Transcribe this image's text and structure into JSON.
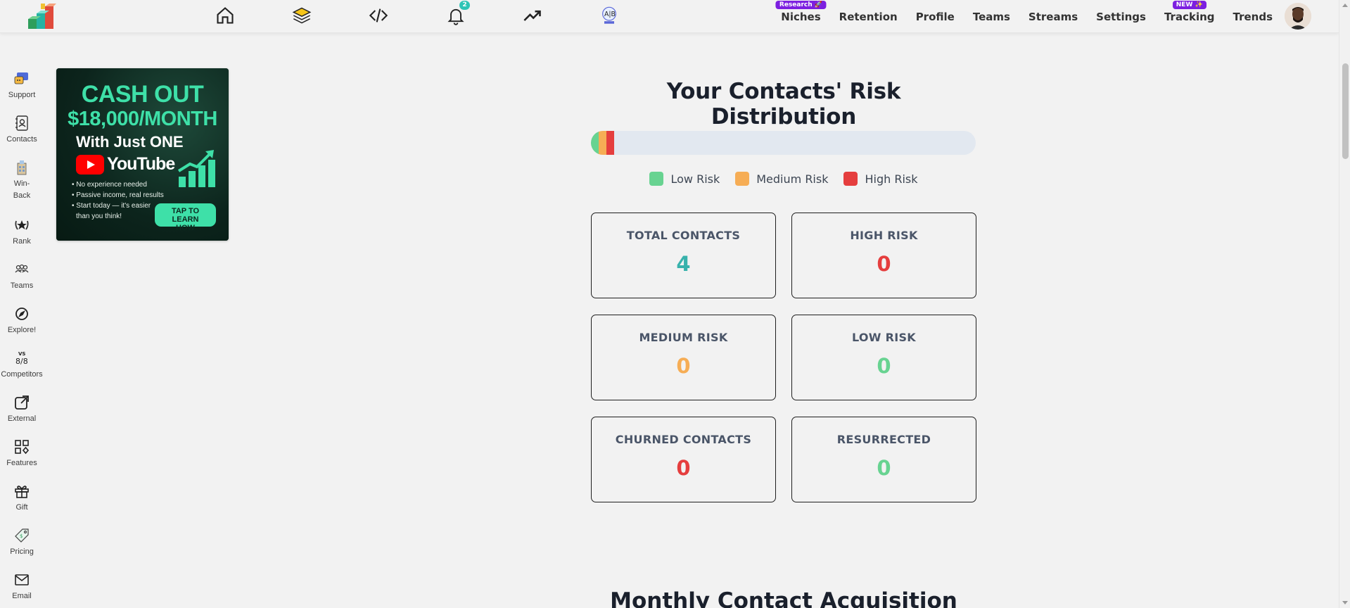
{
  "topnav": {
    "icons": [
      {
        "name": "home-icon"
      },
      {
        "name": "layers-icon"
      },
      {
        "name": "code-icon"
      },
      {
        "name": "bell-icon",
        "badge": "2"
      },
      {
        "name": "trending-up-icon"
      },
      {
        "name": "ab-test-icon"
      }
    ],
    "links": [
      {
        "label": "Niches",
        "tag": "Research 🚀"
      },
      {
        "label": "Retention",
        "tag": ""
      },
      {
        "label": "Profile",
        "tag": ""
      },
      {
        "label": "Teams",
        "tag": ""
      },
      {
        "label": "Streams",
        "tag": ""
      },
      {
        "label": "Settings",
        "tag": ""
      },
      {
        "label": "Tracking",
        "tag": "NEW ✨"
      },
      {
        "label": "Trends",
        "tag": ""
      }
    ]
  },
  "sidebar": {
    "items": [
      {
        "label": "Support",
        "icon": "support-icon"
      },
      {
        "label": "Contacts",
        "icon": "contacts-icon"
      },
      {
        "label": "Win-Back",
        "icon": "win-back-icon"
      },
      {
        "label": "Rank",
        "icon": "rank-icon"
      },
      {
        "label": "Teams",
        "icon": "teams-icon"
      },
      {
        "label": "Explore!",
        "icon": "explore-icon"
      },
      {
        "label": "Competitors",
        "icon": "competitors-icon"
      },
      {
        "label": "External",
        "icon": "external-icon"
      },
      {
        "label": "Features",
        "icon": "features-icon"
      },
      {
        "label": "Gift",
        "icon": "gift-icon"
      },
      {
        "label": "Pricing",
        "icon": "pricing-icon"
      },
      {
        "label": "Email",
        "icon": "email-icon"
      }
    ]
  },
  "ad": {
    "line1": "CASH OUT",
    "line2": "$18,000/MONTH",
    "line3": "With Just ONE",
    "brand": "YouTube",
    "bullets": [
      "• No experience needed",
      "• Passive income, real results",
      "• Start today — it's easier",
      "  than you think!"
    ],
    "cta": "TAP TO LEARN HOW"
  },
  "risk": {
    "title": "Your Contacts' Risk Distribution",
    "distribution": [
      {
        "label": "Low Risk",
        "percent": 2,
        "color": "#68d391"
      },
      {
        "label": "Medium Risk",
        "percent": 2,
        "color": "#f6ad55"
      },
      {
        "label": "High Risk",
        "percent": 2,
        "color": "#e53e3e"
      }
    ],
    "cards": [
      {
        "label": "TOTAL CONTACTS",
        "value": "4",
        "color": "#38b2ac"
      },
      {
        "label": "HIGH RISK",
        "value": "0",
        "color": "#e53e3e"
      },
      {
        "label": "MEDIUM RISK",
        "value": "0",
        "color": "#f6ad55"
      },
      {
        "label": "LOW RISK",
        "value": "0",
        "color": "#68d391"
      },
      {
        "label": "CHURNED CONTACTS",
        "value": "0",
        "color": "#e53e3e"
      },
      {
        "label": "RESURRECTED",
        "value": "0",
        "color": "#68d391"
      }
    ]
  },
  "acquisition": {
    "title": "Monthly Contact Acquisition"
  }
}
